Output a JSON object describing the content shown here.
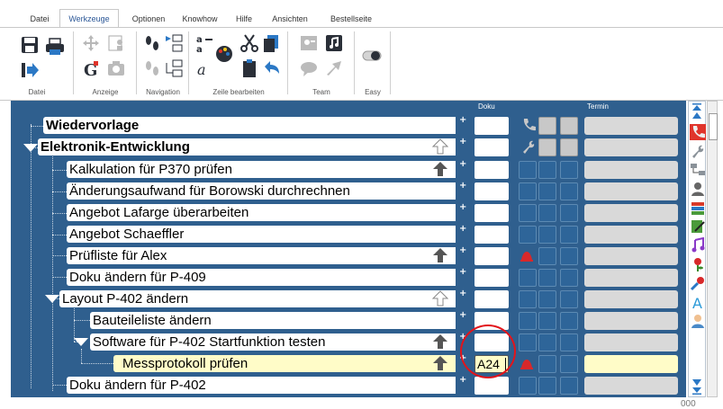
{
  "tabs": [
    "Datei",
    "Werkzeuge",
    "Optionen",
    "Knowhow",
    "Hilfe",
    "Ansichten",
    "Bestellseite"
  ],
  "active_tab": "Werkzeuge",
  "ribbon_groups": [
    "Datei",
    "Anzeige",
    "Navigation",
    "Zeile bearbeiten",
    "Team",
    "Easy"
  ],
  "columns": {
    "doku": "Doku",
    "termin": "Termin"
  },
  "rows": [
    {
      "label": "Wiedervorlage",
      "bold": true
    },
    {
      "label": "Elektronik-Entwicklung",
      "bold": true
    },
    {
      "label": "Kalkulation für P370 prüfen"
    },
    {
      "label": "Änderungsaufwand für Borowski durchrechnen"
    },
    {
      "label": "Angebot Lafarge überarbeiten"
    },
    {
      "label": "Angebot Schaeffler"
    },
    {
      "label": "Prüfliste für Alex"
    },
    {
      "label": "Doku ändern für P-409"
    },
    {
      "label": "Layout P-402 ändern"
    },
    {
      "label": "Bauteileliste ändern"
    },
    {
      "label": "Software für P-402 Startfunktion testen"
    },
    {
      "label": "Messprotokoll prüfen"
    },
    {
      "label": "Doku ändern für P-402"
    }
  ],
  "doku_edit_value": "A24",
  "bottom_partial_text": "000",
  "colors": {
    "panel": "#2f5f8e",
    "highlight": "#fffcc8",
    "circle": "#e2141b",
    "active_tab": "#2b5797"
  },
  "sidebar_icons": [
    "phone-icon",
    "wrench-icon",
    "network-icon",
    "person-icon",
    "books-icon",
    "pen-icon",
    "music-icon",
    "flower-icon",
    "repair-icon",
    "letter-a-icon",
    "user-icon"
  ]
}
